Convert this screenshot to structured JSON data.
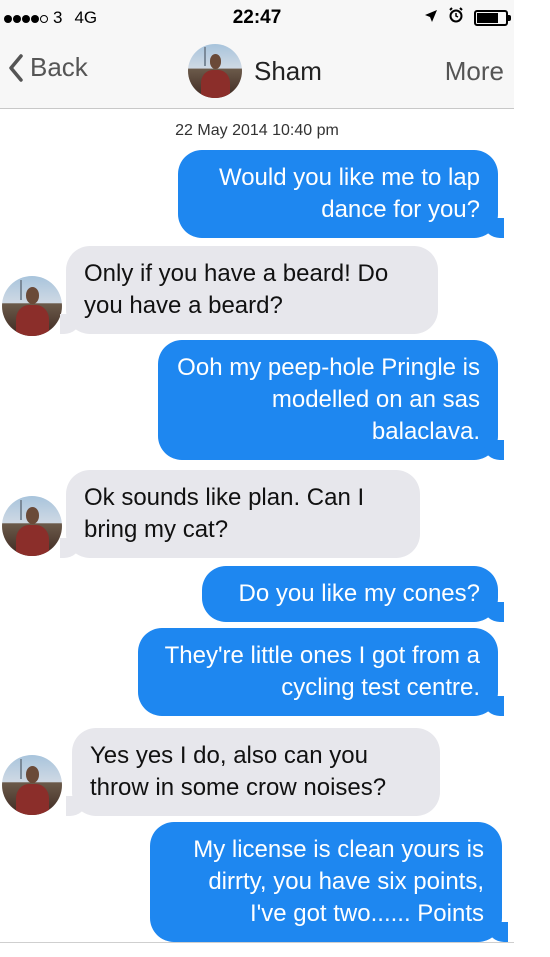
{
  "status_bar": {
    "carrier": "3",
    "network": "4G",
    "time": "22:47",
    "signal_dots_filled": 4,
    "signal_dots_total": 5
  },
  "nav": {
    "back_label": "Back",
    "contact_name": "Sham",
    "more_label": "More"
  },
  "conversation": {
    "timestamp": "22 May 2014 10:40 pm",
    "messages": [
      {
        "direction": "outgoing",
        "text": "Would you like me to lap dance for you?"
      },
      {
        "direction": "incoming",
        "text": "Only if you have a beard! Do you have a beard?"
      },
      {
        "direction": "outgoing",
        "text": "Ooh my peep-hole Pringle is modelled on an sas balaclava."
      },
      {
        "direction": "incoming",
        "text": "Ok sounds like plan. Can I bring my cat?"
      },
      {
        "direction": "outgoing",
        "text": "Do you like my cones?"
      },
      {
        "direction": "outgoing",
        "text": "They're little ones I got from a cycling test centre."
      },
      {
        "direction": "incoming",
        "text": "Yes yes I do, also can you throw in some crow noises?"
      },
      {
        "direction": "outgoing",
        "text": "My license is clean yours is dirrty, you have six points, I've got two...... Points"
      }
    ]
  },
  "colors": {
    "outgoing_bubble": "#1e87f0",
    "incoming_bubble": "#e7e7ec"
  }
}
